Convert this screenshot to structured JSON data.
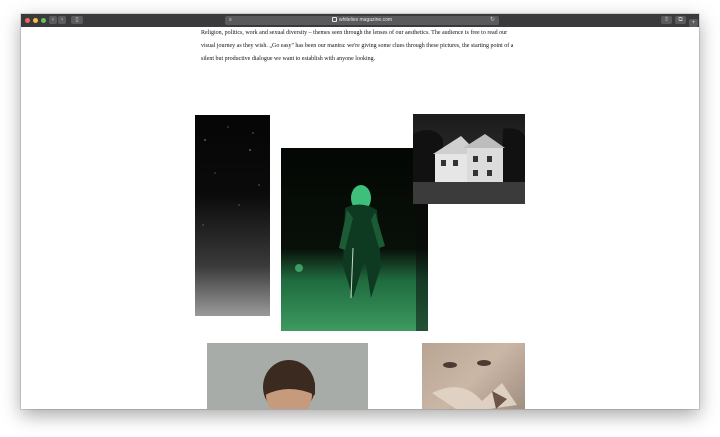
{
  "browser": {
    "url": "whitelies magazine.com",
    "colors": {
      "toolbar": "#3a3a3c",
      "close": "#ed6a5e",
      "minimize": "#f5bf4f",
      "zoom": "#61c554"
    },
    "icons": [
      "back-icon",
      "forward-icon",
      "sidebar-icon",
      "reader-icon",
      "lock-icon",
      "reload-icon",
      "share-icon",
      "tabs-icon",
      "new-tab-icon"
    ]
  },
  "article": {
    "paragraph": "Religion, politics, work and sexual diversity – themes seen through the lenses of our aesthetics. The audience is free to read our visual journey as they wish. „Go easy\" has been our mantra: we're giving some clues through these pictures, the starting point of a silent but productive dialogue we want to establish with anyone looking."
  },
  "gallery": {
    "photos": [
      "night-sky-photo",
      "green-figure-photo",
      "house-photo",
      "portrait-back-photo",
      "face-collage-photo"
    ]
  }
}
